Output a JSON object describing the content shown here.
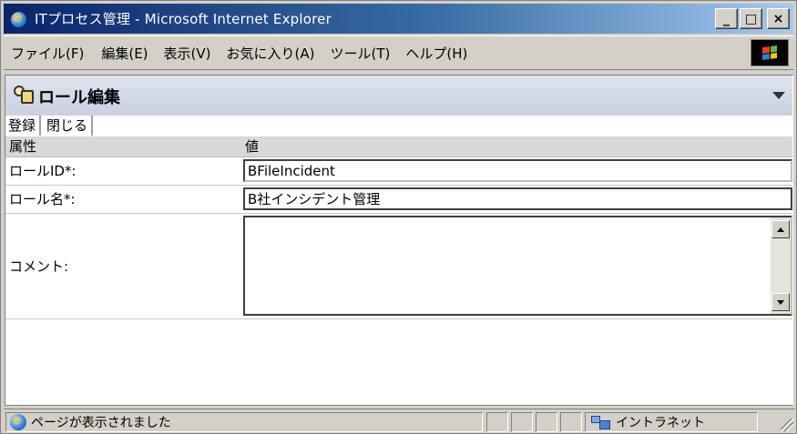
{
  "window": {
    "title": "ITプロセス管理 - Microsoft Internet Explorer",
    "buttons": {
      "minimize": "_",
      "maximize": "□",
      "close": "×"
    }
  },
  "menu": {
    "items": [
      "ファイル(F)",
      "編集(E)",
      "表示(V)",
      "お気に入り(A)",
      "ツール(T)",
      "ヘルプ(H)"
    ]
  },
  "page": {
    "title": "ロール編集",
    "toolbar": {
      "register_label": "登録",
      "close_label": "閉じる"
    },
    "table": {
      "header": {
        "attribute": "属性",
        "value": "値"
      },
      "rows": [
        {
          "label": "ロールID*:",
          "value": "BFileIncident"
        },
        {
          "label": "ロール名*:",
          "value": "B社インシデント管理"
        },
        {
          "label": "コメント:",
          "value": ""
        }
      ]
    }
  },
  "status": {
    "text": "ページが表示されました",
    "zone": "イントラネット"
  }
}
